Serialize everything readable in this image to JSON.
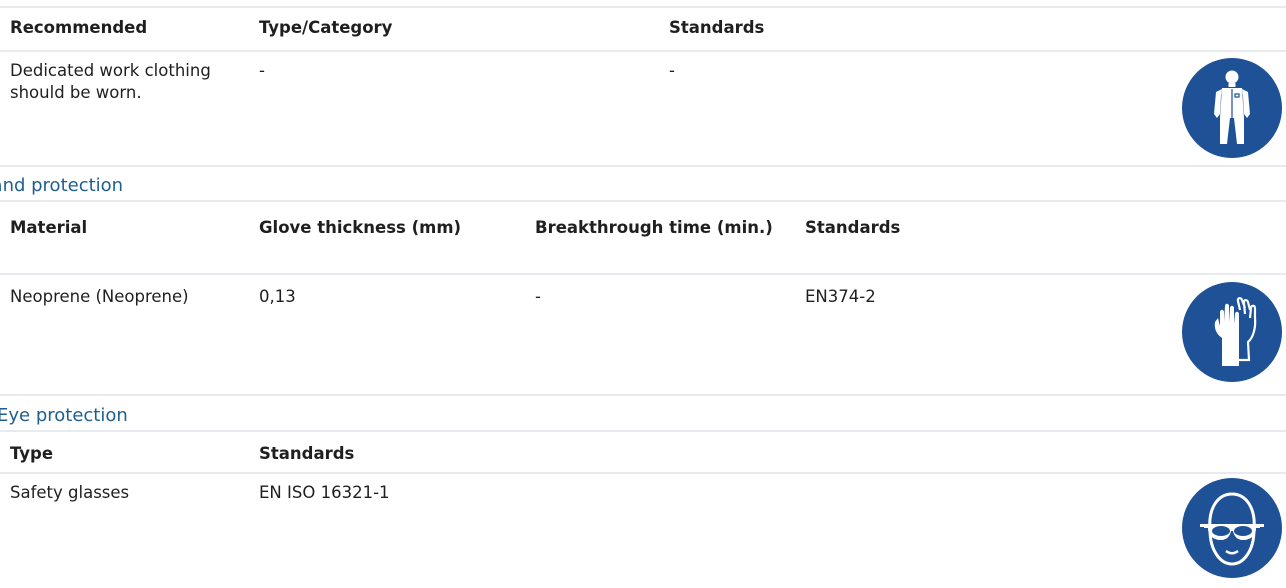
{
  "body_protection": {
    "headers": [
      "Recommended",
      "Type/Category",
      "Standards"
    ],
    "row": [
      "Dedicated work clothing should be worn.",
      "-",
      "-"
    ],
    "icon": "protective-clothing-icon"
  },
  "hand_protection": {
    "title": "Hand protection",
    "headers": [
      "Material",
      "Glove thickness (mm)",
      "Breakthrough time (min.)",
      "Standards"
    ],
    "row": [
      "Neoprene (Neoprene)",
      "0,13",
      "-",
      "EN374-2"
    ],
    "icon": "gloves-icon"
  },
  "eye_protection": {
    "title": "Eye protection",
    "headers": [
      "Type",
      "Standards"
    ],
    "row": [
      "Safety glasses",
      "EN ISO 16321-1"
    ],
    "icon": "safety-glasses-icon"
  },
  "colors": {
    "icon_blue": "#1e5196",
    "title_blue": "#1f5f8f",
    "divider": "#e7eaee"
  }
}
